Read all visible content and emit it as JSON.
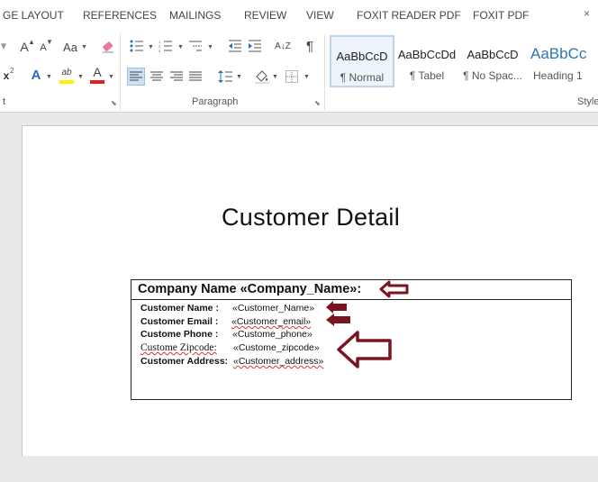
{
  "ribbon_tabs": [
    "GE LAYOUT",
    "REFERENCES",
    "MAILINGS",
    "REVIEW",
    "VIEW",
    "FOXIT READER PDF",
    "FOXIT PDF"
  ],
  "window": {
    "close_glyph": "×"
  },
  "font_group": {
    "grow_label": "A",
    "shrink_label": "A",
    "case_label": "Aa",
    "sub_label": "x",
    "effects_label": "A",
    "highlight_label": "ab",
    "font_color_label": "A",
    "highlight_color": "#ffef00",
    "font_color": "#e02020"
  },
  "paragraph_group": {
    "label": "Paragraph",
    "pilcrow": "¶",
    "sort_label": "A↓Z"
  },
  "styles_group": {
    "label": "Style",
    "styles": [
      {
        "preview": "AaBbCcD",
        "name": "¶ Normal",
        "selected": true
      },
      {
        "preview": "AaBbCcDd",
        "name": "¶ Tabel",
        "selected": false
      },
      {
        "preview": "AaBbCcD",
        "name": "¶ No Spac...",
        "selected": false
      },
      {
        "preview": "AaBbCc",
        "name": "Heading 1",
        "selected": false
      }
    ],
    "heading_color": "#2e74b5"
  },
  "document": {
    "title": "Customer Detail",
    "table": {
      "header": "Company Name «Company_Name»:",
      "rows": [
        {
          "label": "Customer Name  :",
          "field": "«Customer_Name»"
        },
        {
          "label": "Customer Email  :",
          "field": "«Customer_email»"
        },
        {
          "label": "Custome Phone  :",
          "field": "«Custome_phone»"
        },
        {
          "label": "Custome Zipcode:",
          "field": "«Custome_zipcode»"
        },
        {
          "label": "Customer Address:",
          "field": "«Customer_address»"
        }
      ]
    },
    "arrow_color": "#7a1420"
  }
}
